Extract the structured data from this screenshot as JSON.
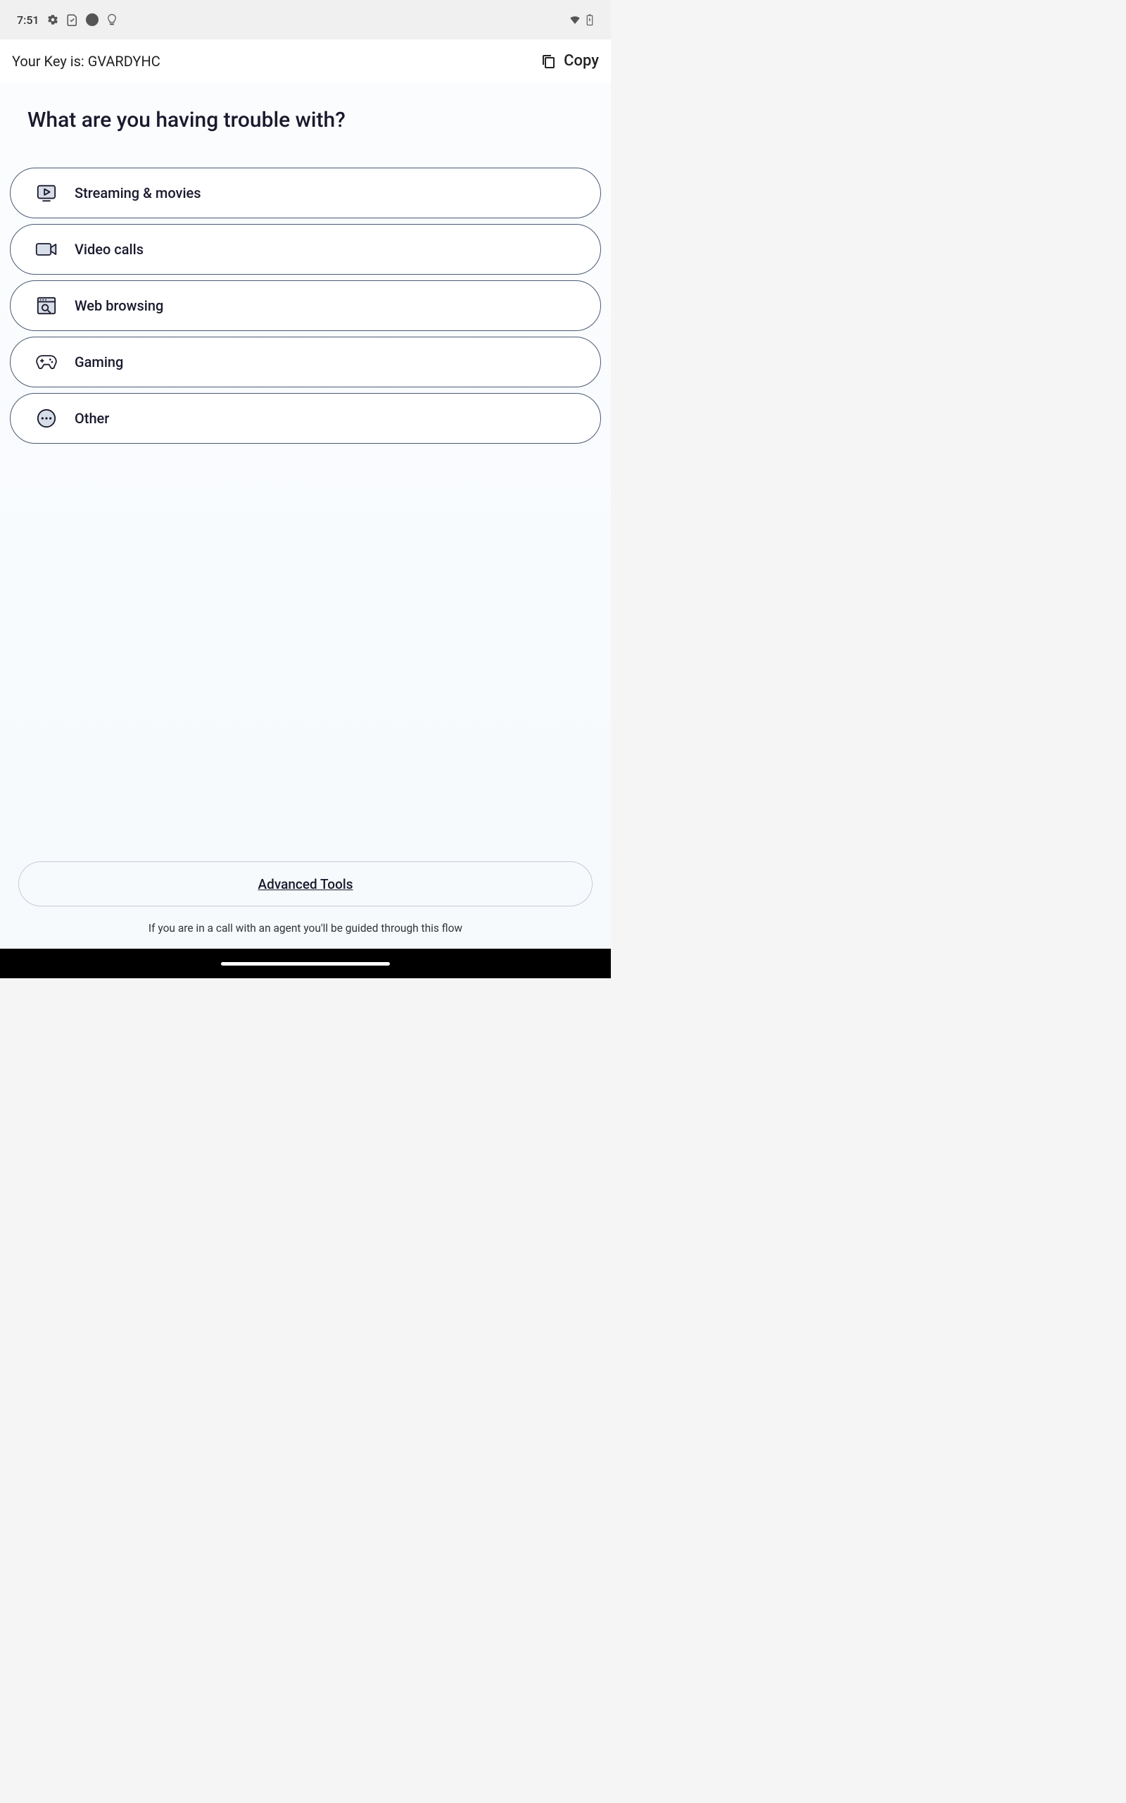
{
  "status_bar": {
    "time": "7:51"
  },
  "key_bar": {
    "label_prefix": "Your Key is: ",
    "key_value": "GVARDYHC",
    "copy_label": "Copy"
  },
  "question": "What are you having trouble with?",
  "options": [
    {
      "label": "Streaming & movies",
      "icon": "play-display-icon"
    },
    {
      "label": "Video calls",
      "icon": "video-camera-icon"
    },
    {
      "label": "Web browsing",
      "icon": "browser-search-icon"
    },
    {
      "label": "Gaming",
      "icon": "game-controller-icon"
    },
    {
      "label": "Other",
      "icon": "ellipsis-circle-icon"
    }
  ],
  "advanced_tools_label": "Advanced Tools",
  "guide_text": "If you are in a call with an agent you'll be guided through this flow"
}
